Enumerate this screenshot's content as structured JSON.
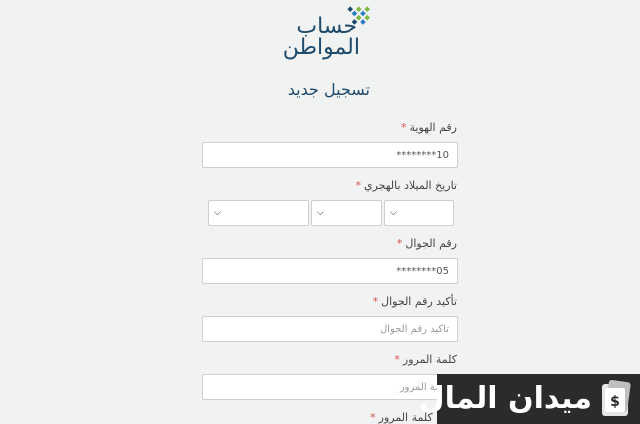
{
  "logo": {
    "line1": "حساب",
    "line2": "المواطن",
    "colors": {
      "green": "#7dbb43",
      "blue": "#2b7bbf",
      "navy": "#1e4a6b"
    }
  },
  "page_title": "تسجيل جديد",
  "required_mark": "*",
  "form": {
    "id_number": {
      "label": "رقم الهوية",
      "value": "10********"
    },
    "dob": {
      "label": "تاريخ الميلاد بالهجري",
      "day": {
        "value": ""
      },
      "month": {
        "value": ""
      },
      "year": {
        "value": ""
      }
    },
    "mobile": {
      "label": "رقم الجوال",
      "value": "05********"
    },
    "confirm_mobile": {
      "label": "تأكيد رقم الجوال",
      "placeholder": "تأكيد رقم الجوال"
    },
    "password": {
      "label": "كلمة المرور",
      "placeholder": "كلمة المرور"
    },
    "confirm_password": {
      "label": "تأكيد كلمة المرور"
    }
  },
  "watermark": {
    "text": "ميدان المال",
    "icon": "money-phone-icon"
  }
}
